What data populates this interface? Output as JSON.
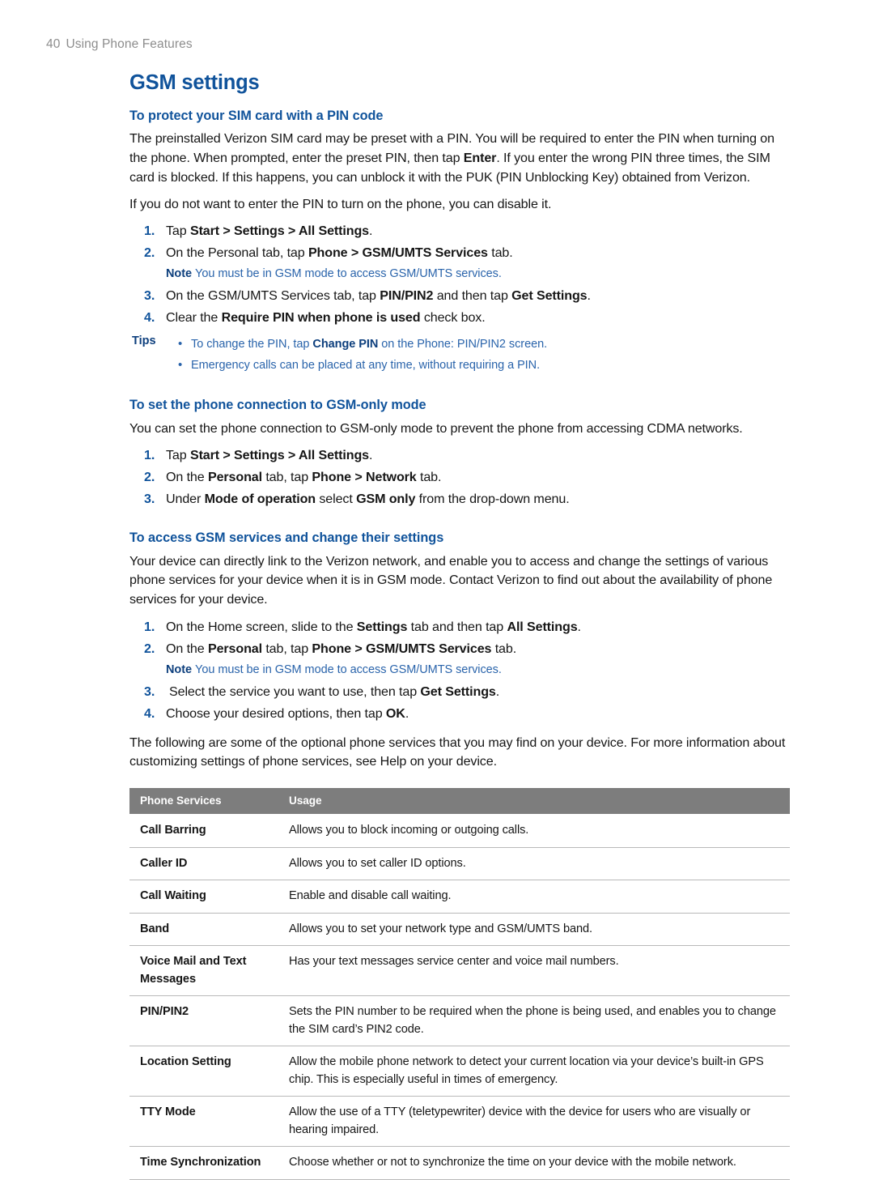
{
  "running_header": {
    "page_number": "40",
    "title": "Using Phone Features"
  },
  "chapter_title": "GSM settings",
  "sections": [
    {
      "heading": "To protect your SIM card with a PIN code",
      "paragraphs": [
        "The preinstalled Verizon SIM card may be preset with a PIN. You will be required to enter the PIN when turning on the phone. When prompted, enter the preset PIN, then tap <b>Enter</b>. If you enter the wrong PIN three times, the SIM card is blocked. If this happens, you can unblock it with the PUK (PIN Unblocking Key) obtained from Verizon.",
        "If you do not want to enter the PIN to turn on the phone, you can disable it."
      ],
      "steps": [
        {
          "num": "1.",
          "text": "Tap <b>Start > Settings > All Settings</b>."
        },
        {
          "num": "2.",
          "text": "On the Personal tab, tap <b>Phone > GSM/UMTS Services</b> tab."
        },
        {
          "num": "3.",
          "text": "On the GSM/UMTS Services tab, tap <b>PIN/PIN2</b> and then tap <b>Get Settings</b>."
        },
        {
          "num": "4.",
          "text": "Clear the <b>Require PIN when phone is used</b> check box."
        }
      ],
      "note": {
        "label": "Note",
        "text": "You must be in GSM mode to access GSM/UMTS services."
      },
      "tips": {
        "label": "Tips",
        "items": [
          "To change the PIN, tap <b>Change PIN</b> on the Phone: PIN/PIN2 screen.",
          "Emergency calls can be placed at any time, without requiring a PIN."
        ]
      }
    },
    {
      "heading": "To set the phone connection to GSM-only mode",
      "paragraphs": [
        "You can set the phone connection to GSM-only mode to prevent the phone from accessing CDMA networks."
      ],
      "steps": [
        {
          "num": "1.",
          "text": "Tap <b>Start > Settings > All Settings</b>."
        },
        {
          "num": "2.",
          "text": "On the <b>Personal</b> tab, tap <b>Phone > Network</b> tab."
        },
        {
          "num": "3.",
          "text": "Under <b>Mode of operation</b> select <b>GSM only</b> from the drop-down menu."
        }
      ]
    },
    {
      "heading": "To access GSM services and change their settings",
      "paragraphs": [
        "Your device can directly link to the Verizon network, and enable you to access and change the settings of various phone services for your device when it is in GSM mode. Contact Verizon to find out about the availability of phone services for your device."
      ],
      "steps": [
        {
          "num": "1.",
          "text": "On the Home screen, slide to the <b>Settings</b> tab and then tap <b>All Settings</b>."
        },
        {
          "num": "2.",
          "text": "On the <b>Personal</b> tab, tap <b>Phone > GSM/UMTS Services</b> tab."
        },
        {
          "num": "3.",
          "text": "Select the service you want to use, then tap <b>Get Settings</b>."
        },
        {
          "num": "4.",
          "text": "Choose your desired options, then tap <b>OK</b>."
        }
      ],
      "note": {
        "label": "Note",
        "text": "You must be in GSM mode to access GSM/UMTS services."
      },
      "closing_paragraph": "The following are some of the optional phone services that you may find on your device. For more information about customizing settings of phone services, see Help on your device."
    }
  ],
  "services_table": {
    "headers": [
      "Phone Services",
      "Usage"
    ],
    "rows": [
      {
        "service": "Call Barring",
        "usage": "Allows you to block incoming or outgoing calls."
      },
      {
        "service": "Caller ID",
        "usage": "Allows you to set caller ID options."
      },
      {
        "service": "Call Waiting",
        "usage": "Enable and disable call waiting."
      },
      {
        "service": "Band",
        "usage": "Allows you to set your network type and GSM/UMTS band."
      },
      {
        "service": "Voice Mail and Text Messages",
        "usage": "Has your text messages service center and voice mail numbers."
      },
      {
        "service": "PIN/PIN2",
        "usage": "Sets the PIN number to be required when the phone is being used, and enables you to change the SIM card’s PIN2 code."
      },
      {
        "service": "Location Setting",
        "usage": "Allow the mobile phone network to detect your current location via your device’s built-in GPS chip. This is especially useful in times of emergency."
      },
      {
        "service": "TTY Mode",
        "usage": "Allow the use of a TTY (teletypewriter) device with the device for users who are visually or hearing impaired."
      },
      {
        "service": "Time Synchronization",
        "usage": "Choose whether or not to synchronize the time on your device with the mobile network."
      }
    ]
  },
  "colors": {
    "heading_blue": "#10539b",
    "note_blue": "#2a64ab",
    "note_label_blue": "#0d3f7d",
    "table_header_grey": "#7d7d7d",
    "rule_grey": "#b9b9b9",
    "running_header_grey": "#8d8d8d",
    "body_text": "#161616"
  }
}
